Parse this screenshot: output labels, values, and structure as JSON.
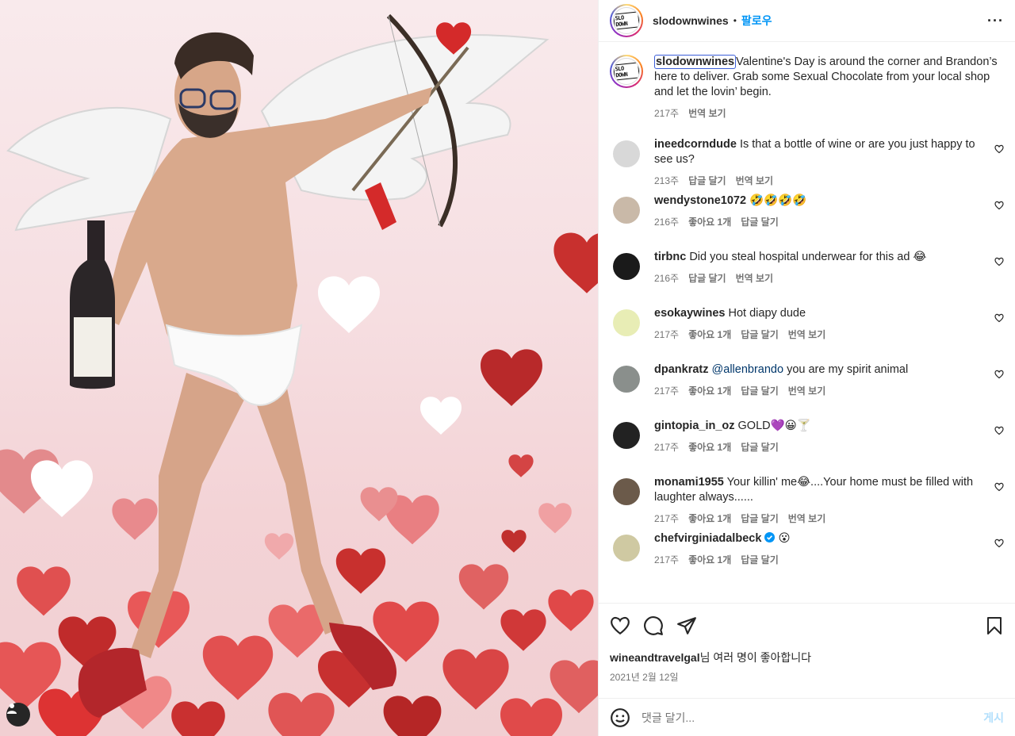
{
  "account": {
    "username": "slodownwines",
    "follow_label": "팔로우",
    "logo_text": "SLO DOWN"
  },
  "caption": {
    "username": "slodownwines",
    "text": "Valentine's Day is around the corner and Brandon’s here to deliver. Grab some Sexual Chocolate from your local shop and let the lovin’ begin.",
    "time": "217주",
    "translate": "번역 보기"
  },
  "comments": [
    {
      "username": "ineedcorndude",
      "text": "Is that a bottle of wine or are you just happy to see us?",
      "time": "213주",
      "likes": "",
      "reply": "답글 달기",
      "translate": "번역 보기",
      "avatar_color": "#d8d8d8"
    },
    {
      "username": "wendystone1072",
      "text": "🤣🤣🤣🤣",
      "time": "216주",
      "likes": "좋아요 1개",
      "reply": "답글 달기",
      "translate": "",
      "avatar_color": "#c9b9a8"
    },
    {
      "username": "tirbnc",
      "text": "Did you steal hospital underwear for this ad 😂",
      "time": "216주",
      "likes": "",
      "reply": "답글 달기",
      "translate": "번역 보기",
      "avatar_color": "#1a1a1a"
    },
    {
      "username": "esokaywines",
      "text": "Hot diapy dude",
      "time": "217주",
      "likes": "좋아요 1개",
      "reply": "답글 달기",
      "translate": "번역 보기",
      "avatar_color": "#e8edb5"
    },
    {
      "username": "dpankratz",
      "mention": "@allenbrando",
      "text": "you are my spirit animal",
      "time": "217주",
      "likes": "좋아요 1개",
      "reply": "답글 달기",
      "translate": "번역 보기",
      "avatar_color": "#8a8f8c"
    },
    {
      "username": "gintopia_in_oz",
      "text": "GOLD💜😀🍸",
      "time": "217주",
      "likes": "좋아요 1개",
      "reply": "답글 달기",
      "translate": "",
      "avatar_color": "#222222"
    },
    {
      "username": "monami1955",
      "text": "Your killin' me😂....Your home must be filled with laughter always......",
      "time": "217주",
      "likes": "좋아요 1개",
      "reply": "답글 달기",
      "translate": "번역 보기",
      "avatar_color": "#6b5a4a"
    },
    {
      "username": "chefvirginiadalbeck",
      "verified": true,
      "text": "😮",
      "time": "217주",
      "likes": "좋아요 1개",
      "reply": "답글 달기",
      "translate": "",
      "avatar_color": "#cfc9a2"
    }
  ],
  "likes_line": {
    "user": "wineandtravelgal",
    "rest": "님 여러 명이 좋아합니다"
  },
  "date": "2021년 2월 12일",
  "add_comment": {
    "placeholder": "댓글 달기...",
    "post": "게시"
  },
  "icons": [
    "heart-icon",
    "comment-icon",
    "share-icon",
    "bookmark-icon",
    "emoji-icon",
    "more-icon",
    "tag-user-icon"
  ],
  "colors": {
    "accent": "#0095f6",
    "muted": "#737373",
    "heart_red": "#c0302e"
  }
}
